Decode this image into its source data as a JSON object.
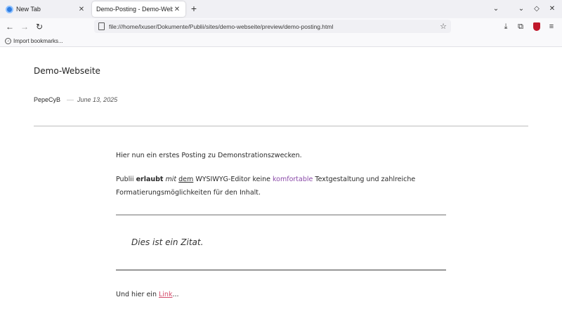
{
  "browser": {
    "tabs": [
      {
        "title": "New Tab",
        "active": false
      },
      {
        "title": "Demo-Posting - Demo-Webseit",
        "active": true
      }
    ],
    "url": "file:///home/lxuser/Dokumente/Publii/sites/demo-webseite/preview/demo-posting.html",
    "bookmarks": {
      "import_label": "Import bookmarks..."
    }
  },
  "page": {
    "site_title": "Demo-Webseite",
    "author": "PepeCyB",
    "date": "June 13, 2025",
    "paragraph1": "Hier nun ein erstes Posting zu Demonstrationszwecken.",
    "paragraph2": {
      "part1": "Publii ",
      "bold": "erlaubt",
      "part2": " ",
      "italic": "mit",
      "part3": " ",
      "underline": "dem",
      "part4": " WYSIWYG-Editor keine ",
      "colored": "komfortable",
      "part5": " Textgestaltung und zahlreiche Formatierungsmöglichkeiten für den Inhalt."
    },
    "quote": "Dies ist ein Zitat.",
    "paragraph3": {
      "before": "Und hier ein ",
      "link": "Link",
      "after": "..."
    }
  },
  "colors": {
    "colored_text": "#8a4aa8",
    "link": "#d44a6a"
  }
}
